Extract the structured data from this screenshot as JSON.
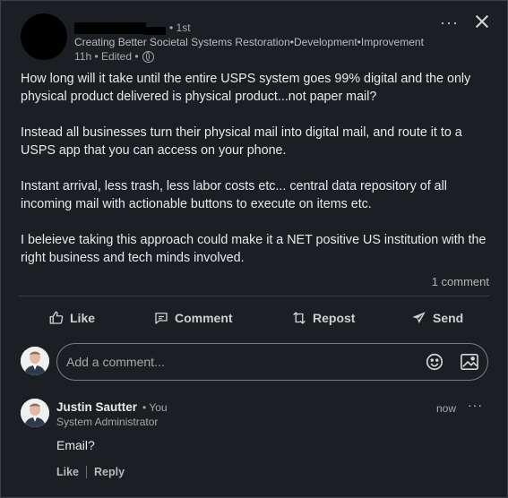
{
  "post": {
    "degree": "• 1st",
    "headline": "Creating Better Societal Systems Restoration•Development•Improvement",
    "meta": "11h • Edited •",
    "paragraphs": [
      "How long will it take until the entire USPS system goes 99% digital and the only physical product delivered is physical product...not paper mail?",
      "Instead all businesses turn their physical mail into digital mail, and route it to a USPS app that you can access on your phone.",
      "Instant arrival, less trash, less labor costs etc... central data repository of all incoming mail with actionable buttons to execute on items etc.",
      "I beleieve taking this approach could make it a NET positive US institution with the right business and tech minds involved."
    ],
    "comment_count": "1 comment"
  },
  "header": {
    "more_label": "···"
  },
  "actions": {
    "like": "Like",
    "comment": "Comment",
    "repost": "Repost",
    "send": "Send"
  },
  "comment_box": {
    "placeholder": "Add a comment..."
  },
  "comment": {
    "name": "Justin Sautter",
    "you": "• You",
    "title": "System Administrator",
    "time": "now",
    "more": "···",
    "text": "Email?",
    "like": "Like",
    "reply": "Reply"
  },
  "icons": {
    "like": "thumbs-up-icon",
    "comment": "comment-icon",
    "repost": "repost-icon",
    "send": "send-icon"
  }
}
